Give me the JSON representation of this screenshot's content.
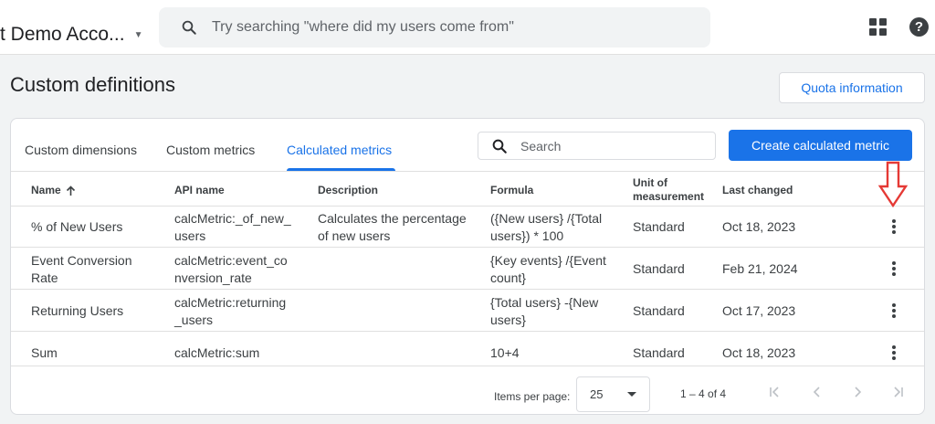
{
  "topbar": {
    "account_name": "t Demo Acco...",
    "search_placeholder": "Try searching \"where did my users come from\"",
    "help_label": "?"
  },
  "page": {
    "title": "Custom definitions",
    "quota_button": "Quota information"
  },
  "tabs": [
    {
      "label": "Custom dimensions",
      "active": false
    },
    {
      "label": "Custom metrics",
      "active": false
    },
    {
      "label": "Calculated metrics",
      "active": true
    }
  ],
  "table_search_placeholder": "Search",
  "create_button": "Create calculated metric",
  "columns": {
    "name": "Name",
    "api_name": "API name",
    "description": "Description",
    "formula": "Formula",
    "unit_line1": "Unit of",
    "unit_line2": "measurement",
    "last_changed": "Last changed"
  },
  "rows": [
    {
      "name": [
        "% of New Users"
      ],
      "api": [
        "calcMetric:_of_new_",
        "users"
      ],
      "description": [
        "Calculates the percentage",
        "of new users"
      ],
      "formula": [
        "({New users} /{Total",
        "users}) * 100"
      ],
      "unit": "Standard",
      "changed": "Oct 18, 2023"
    },
    {
      "name": [
        "Event Conversion",
        "Rate"
      ],
      "api": [
        "calcMetric:event_co",
        "nversion_rate"
      ],
      "description": [],
      "formula": [
        "{Key events} /{Event",
        "count}"
      ],
      "unit": "Standard",
      "changed": "Feb 21, 2024"
    },
    {
      "name": [
        "Returning Users"
      ],
      "api": [
        "calcMetric:returning",
        "_users"
      ],
      "description": [],
      "formula": [
        "{Total users} -{New",
        "users}"
      ],
      "unit": "Standard",
      "changed": "Oct 17, 2023"
    },
    {
      "name": [
        "Sum"
      ],
      "api": [
        "calcMetric:sum"
      ],
      "description": [],
      "formula": [
        "10+4"
      ],
      "unit": "Standard",
      "changed": "Oct 18, 2023"
    }
  ],
  "footer": {
    "items_per_page_label": "Items per page:",
    "items_per_page_value": "25",
    "range": "1 – 4 of 4"
  },
  "colors": {
    "accent": "#1a73e8",
    "annotation_arrow": "#e53935"
  }
}
